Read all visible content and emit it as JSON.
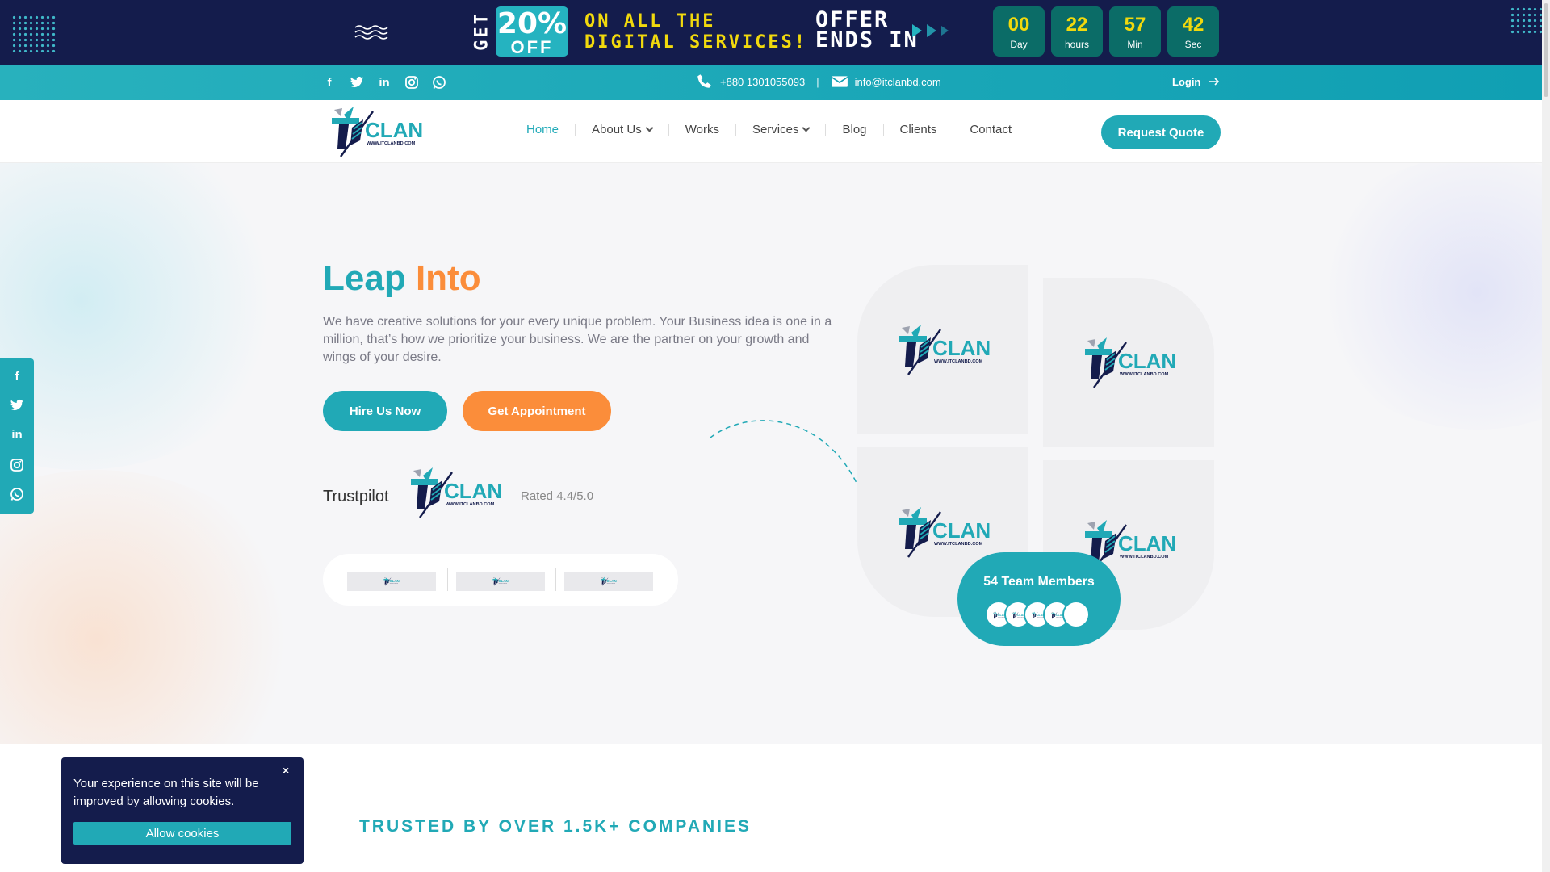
{
  "promo": {
    "get": "GET",
    "percent": "20%",
    "off": "OFF",
    "line1": "ON ALL THE",
    "line2": "DIGITAL SERVICES!",
    "offer1": "OFFER",
    "offer2": "ENDS IN",
    "countdown": [
      {
        "value": "00",
        "unit": "Day"
      },
      {
        "value": "22",
        "unit": "hours"
      },
      {
        "value": "57",
        "unit": "Min"
      },
      {
        "value": "42",
        "unit": "Sec"
      }
    ]
  },
  "topbar": {
    "phone": "+880 1301055093",
    "email": "info@itclanbd.com",
    "login": "Login"
  },
  "nav": {
    "items": [
      {
        "label": "Home",
        "active": true
      },
      {
        "label": "About Us",
        "dropdown": true
      },
      {
        "label": "Works"
      },
      {
        "label": "Services",
        "dropdown": true
      },
      {
        "label": "Blog"
      },
      {
        "label": "Clients"
      },
      {
        "label": "Contact"
      }
    ],
    "cta": "Request Quote"
  },
  "hero": {
    "title_a": "Leap",
    "title_b": "Into",
    "lead": "We have creative solutions for your every unique problem. Your Business idea is one in a million, that’s how we prioritize your business. We are the partner on your growth and wings of your desire.",
    "hire": "Hire Us Now",
    "appointment": "Get Appointment",
    "trustpilot": "Trustpilot",
    "rated": "Rated 4.4/5.0",
    "team": "54 Team Members"
  },
  "trusted": "TRUSTED BY OVER 1.5K+ COMPANIES",
  "cookie": {
    "message": "Your experience on this site will be improved by allowing cookies.",
    "close": "×",
    "allow": "Allow cookies"
  },
  "colors": {
    "teal": "#21a9b6",
    "orange": "#fb8d3a",
    "navy": "#141c4c",
    "yellow": "#f1d90d"
  },
  "logo": {
    "wordmark": "CLAN",
    "url": "WWW.ITCLANBD.COM"
  },
  "icons": [
    "facebook-icon",
    "twitter-icon",
    "linkedin-icon",
    "instagram-icon",
    "whatsapp-icon",
    "phone-icon",
    "mail-icon",
    "arrow-right-icon"
  ]
}
